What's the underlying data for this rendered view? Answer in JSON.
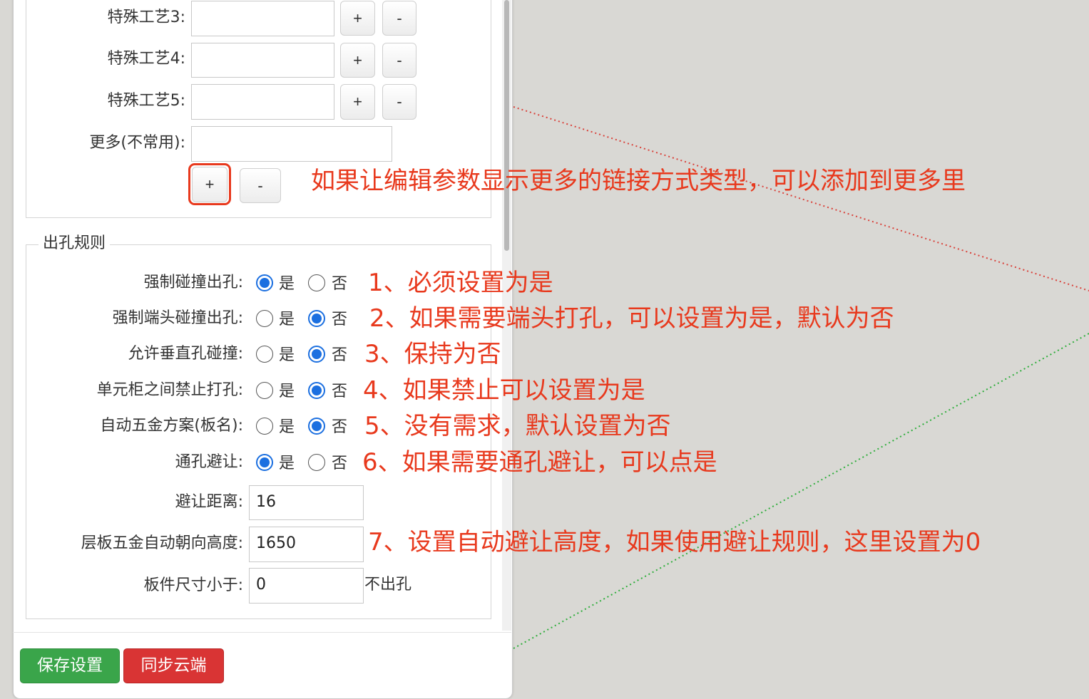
{
  "special_crafts": [
    {
      "label": "特殊工艺3:",
      "value": "",
      "add": "+",
      "remove": "-"
    },
    {
      "label": "特殊工艺4:",
      "value": "",
      "add": "+",
      "remove": "-"
    },
    {
      "label": "特殊工艺5:",
      "value": "",
      "add": "+",
      "remove": "-"
    }
  ],
  "more": {
    "label": "更多(不常用):",
    "value": "",
    "add": "+",
    "remove": "-"
  },
  "hole_rules": {
    "legend": "出孔规则",
    "yes": "是",
    "no": "否",
    "options": [
      {
        "label": "强制碰撞出孔:",
        "selected": "是"
      },
      {
        "label": "强制端头碰撞出孔:",
        "selected": "否"
      },
      {
        "label": "允许垂直孔碰撞:",
        "selected": "否"
      },
      {
        "label": "单元柜之间禁止打孔:",
        "selected": "否"
      },
      {
        "label": "自动五金方案(板名):",
        "selected": "否"
      },
      {
        "label": "通孔避让:",
        "selected": "是"
      }
    ],
    "avoid_distance": {
      "label": "避让距离:",
      "value": "16"
    },
    "shelf_height": {
      "label": "层板五金自动朝向高度:",
      "value": "1650"
    },
    "min_size": {
      "label": "板件尺寸小于:",
      "value": "0",
      "suffix": "不出孔"
    }
  },
  "footer": {
    "save": "保存设置",
    "sync": "同步云端"
  },
  "annotations": {
    "more_note": "如果让编辑参数显示更多的链接方式类型，可以添加到更多里",
    "notes": [
      "1、必须设置为是",
      "2、如果需要端头打孔，可以设置为是，默认为否",
      "3、保持为否",
      "4、如果禁止可以设置为是",
      "5、没有需求，默认设置为否",
      "6、如果需要通孔避让，可以点是",
      "7、设置自动避让高度，如果使用避让规则，这里设置为0"
    ],
    "color": "#e8391d"
  },
  "colors": {
    "save": "#3aa54a",
    "sync": "#d93434",
    "radio": "#1b6fe0",
    "background": "#d9d8d4"
  }
}
